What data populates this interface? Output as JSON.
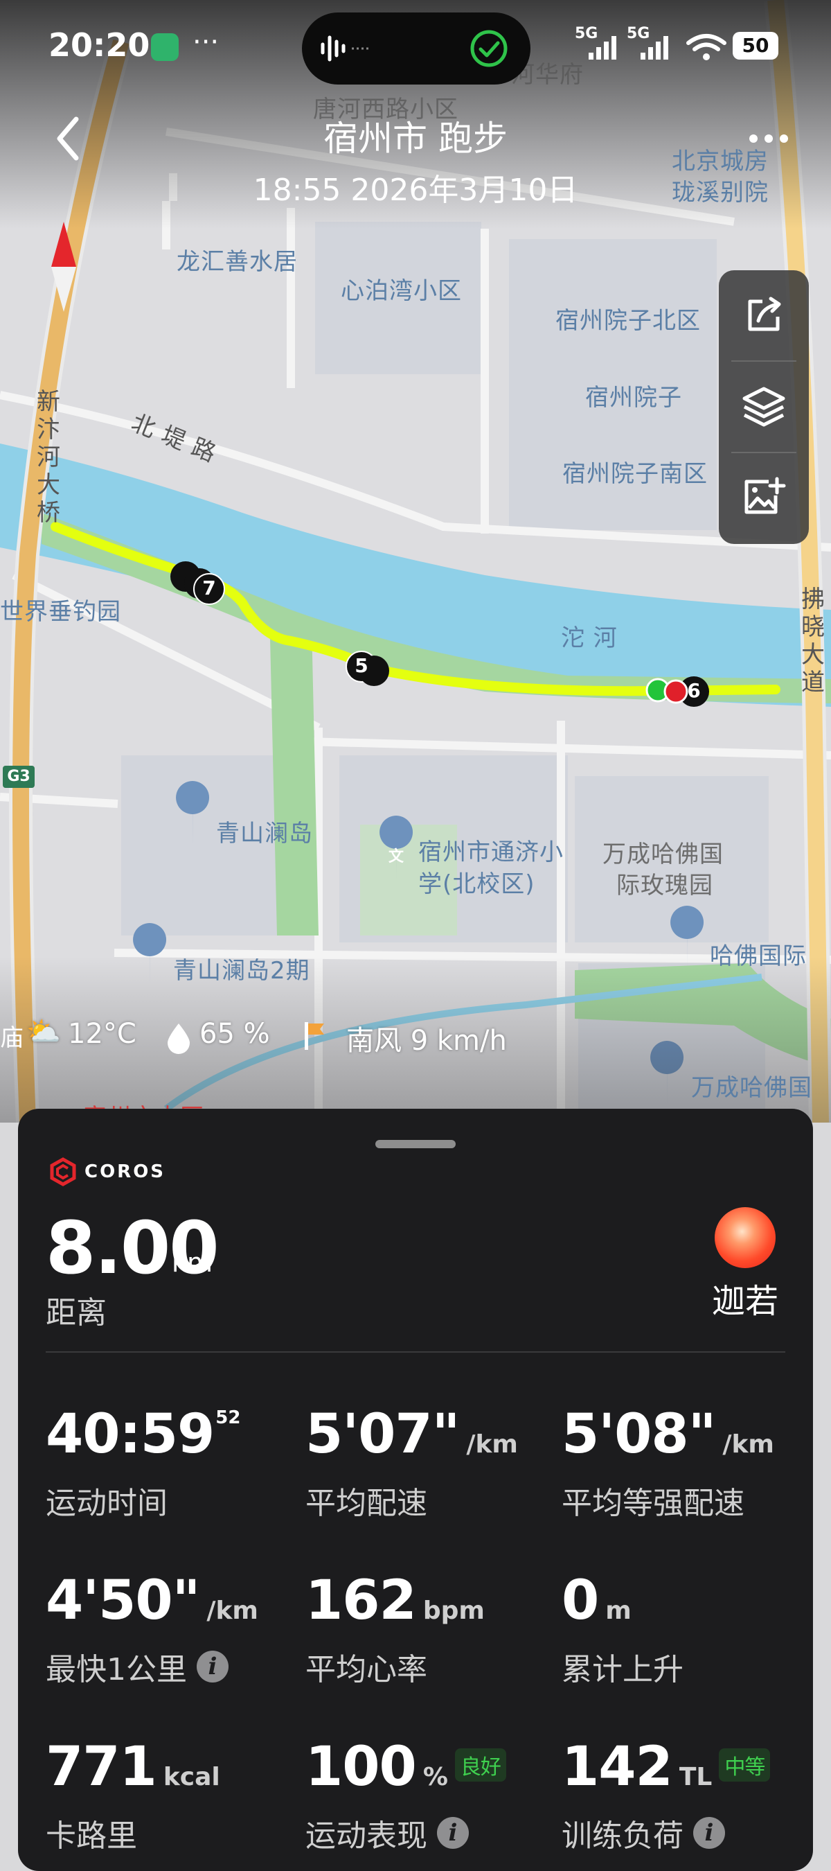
{
  "status_bar": {
    "time": "20:20",
    "signal_1": "5G",
    "signal_2": "5G",
    "battery": "50"
  },
  "header": {
    "title": "宿州市 跑步",
    "subtitle": "18:55 2026年3月10日"
  },
  "map_labels": {
    "tanghexi": "唐河西路小区",
    "hehua": "河华府",
    "beijing_1": "北京城房",
    "beijing_2": "珑溪别院",
    "longhui": "龙汇善水居",
    "xinbowan": "心泊湾小区",
    "yuanzi_north": "宿州院子北区",
    "yuanzi": "宿州院子",
    "yuanzi_south": "宿州院子南区",
    "bridge": "新汴河大桥",
    "beidi": "北 堤 路",
    "fishing": "世界垂钓园",
    "tuohe": "沱 河",
    "fuxiao": "拂晓大道",
    "g3": "G3",
    "qingshan": "青山澜岛",
    "school_1": "宿州市通济小",
    "school_2": "学(北校区)",
    "wancheng_1": "万成哈佛国",
    "wancheng_2": "际玫瑰园",
    "qingshan2": "青山澜岛2期",
    "hafo": "哈佛国际",
    "wancheng_hafo": "万成哈佛国",
    "temple": "庙",
    "hospital": "宿州市中医"
  },
  "track_markers": [
    "7",
    "5",
    "6"
  ],
  "weather": {
    "temp": "12°C",
    "humidity": "65 %",
    "wind": "南风 9 km/h"
  },
  "card": {
    "brand": "COROS",
    "distance": {
      "value": "8.00",
      "unit": "km",
      "label": "距离"
    },
    "user": {
      "name": "迦若"
    },
    "stats": [
      {
        "value": "40:59",
        "sup": "52",
        "unit": "",
        "label": "运动时间",
        "badge": ""
      },
      {
        "value": "5'07\"",
        "sup": "",
        "unit": "/km",
        "label": "平均配速",
        "badge": ""
      },
      {
        "value": "5'08\"",
        "sup": "",
        "unit": "/km",
        "label": "平均等强配速",
        "badge": ""
      },
      {
        "value": "4'50\"",
        "sup": "",
        "unit": "/km",
        "label": "最快1公里",
        "badge": ""
      },
      {
        "value": "162",
        "sup": "",
        "unit": "bpm",
        "label": "平均心率",
        "badge": ""
      },
      {
        "value": "0",
        "sup": "",
        "unit": "m",
        "label": "累计上升",
        "badge": ""
      },
      {
        "value": "771",
        "sup": "",
        "unit": "kcal",
        "label": "卡路里",
        "badge": ""
      },
      {
        "value": "100",
        "sup": "",
        "unit": "%",
        "label": "运动表现",
        "badge": "良好"
      },
      {
        "value": "142",
        "sup": "",
        "unit": "TL",
        "label": "训练负荷",
        "badge": "中等"
      }
    ]
  },
  "colors": {
    "track": "#e4ff10",
    "river": "#8fd0e8",
    "green_belt": "#a5d6a0",
    "road": "#f5d38a",
    "card_bg": "#1c1c1e",
    "badge_green": "#3fd04f"
  }
}
